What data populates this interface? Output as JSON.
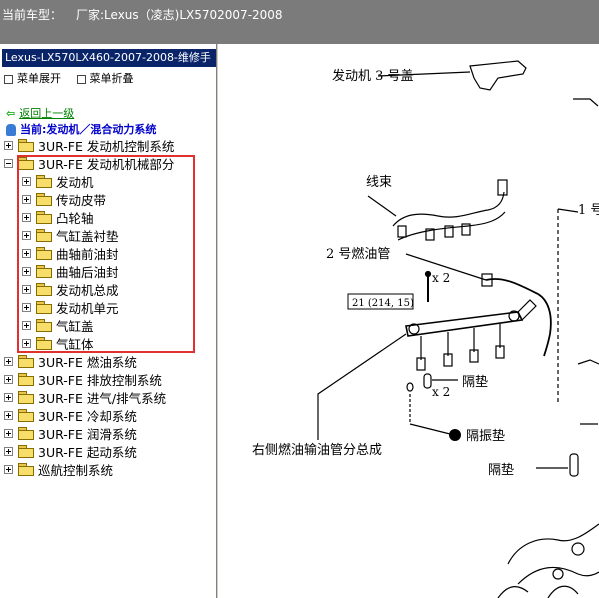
{
  "header": {
    "label": "当前车型：",
    "value": "厂家:Lexus（凌志)LX5702007-2008"
  },
  "sidebar": {
    "title": "Lexus-LX570LX460-2007-2008-维修手",
    "tools": [
      "菜单展开",
      "菜单折叠"
    ],
    "back_link": "返回上一级",
    "current": "当前:发动机／混合动力系统",
    "tree": [
      {
        "label": "3UR-FE 发动机控制系统",
        "level": 0,
        "state": "plus"
      },
      {
        "label": "3UR-FE 发动机机械部分",
        "level": 0,
        "state": "minus"
      },
      {
        "label": "发动机",
        "level": 1,
        "state": "plus"
      },
      {
        "label": "传动皮带",
        "level": 1,
        "state": "plus"
      },
      {
        "label": "凸轮轴",
        "level": 1,
        "state": "plus"
      },
      {
        "label": "气缸盖衬垫",
        "level": 1,
        "state": "plus"
      },
      {
        "label": "曲轴前油封",
        "level": 1,
        "state": "plus"
      },
      {
        "label": "曲轴后油封",
        "level": 1,
        "state": "plus"
      },
      {
        "label": "发动机总成",
        "level": 1,
        "state": "plus"
      },
      {
        "label": "发动机单元",
        "level": 1,
        "state": "plus"
      },
      {
        "label": "气缸盖",
        "level": 1,
        "state": "plus"
      },
      {
        "label": "气缸体",
        "level": 1,
        "state": "plus"
      },
      {
        "label": "3UR-FE 燃油系统",
        "level": 0,
        "state": "plus"
      },
      {
        "label": "3UR-FE 排放控制系统",
        "level": 0,
        "state": "plus"
      },
      {
        "label": "3UR-FE 进气/排气系统",
        "level": 0,
        "state": "plus"
      },
      {
        "label": "3UR-FE 冷却系统",
        "level": 0,
        "state": "plus"
      },
      {
        "label": "3UR-FE 润滑系统",
        "level": 0,
        "state": "plus"
      },
      {
        "label": "3UR-FE 起动系统",
        "level": 0,
        "state": "plus"
      },
      {
        "label": "巡航控制系统",
        "level": 0,
        "state": "plus"
      }
    ]
  },
  "diagram": {
    "labels": {
      "engine_cover": "发动机 3 号盖",
      "harness": "线束",
      "fuel_pipe_2": "2 号燃油管",
      "qty_x2_a": "x 2",
      "torque": "21 (214, 15)",
      "spacer_a": "隔垫",
      "qty_x2_b": "x 2",
      "insulator": "隔振垫",
      "fuel_rail_assembly": "右侧燃油输油管分总成",
      "spacer_b": "隔垫",
      "label_1": "1 号"
    }
  }
}
